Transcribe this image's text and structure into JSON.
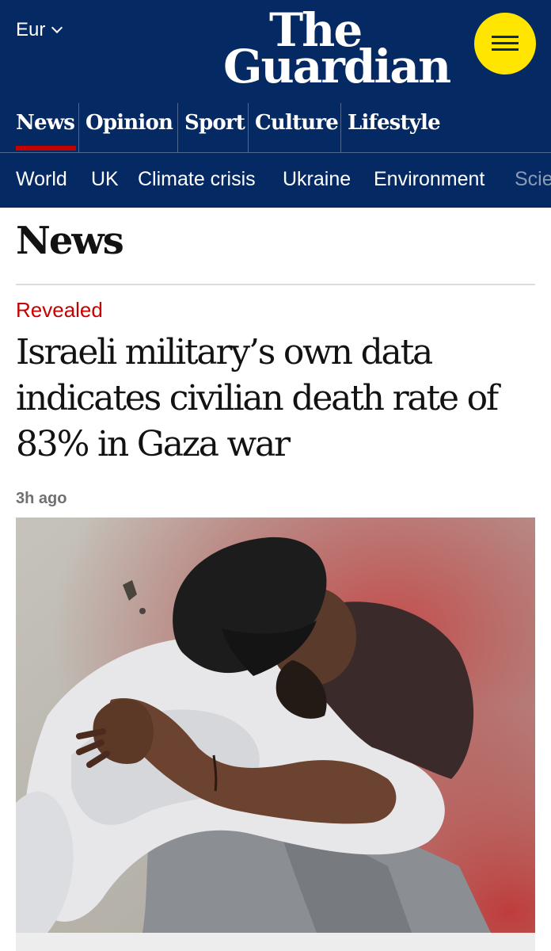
{
  "header": {
    "edition": "Eur",
    "logo_line1": "The",
    "logo_line2": "Guardian",
    "menu_icon": "hamburger-icon",
    "pillars": [
      "News",
      "Opinion",
      "Sport",
      "Culture",
      "Lifestyle"
    ],
    "active_pillar": "News",
    "subnav": [
      "World",
      "UK",
      "Climate crisis",
      "Ukraine",
      "Environment",
      "Scie"
    ]
  },
  "section": {
    "title": "News"
  },
  "article": {
    "kicker": "Revealed",
    "headline": "Israeli military’s own data indicates civilian death rate of 83% in Gaza war",
    "timestamp": "3h ago"
  },
  "colors": {
    "brand_blue": "#052962",
    "menu_yellow": "#ffe500",
    "news_red": "#c70000",
    "text": "#121212",
    "muted": "#707070"
  }
}
